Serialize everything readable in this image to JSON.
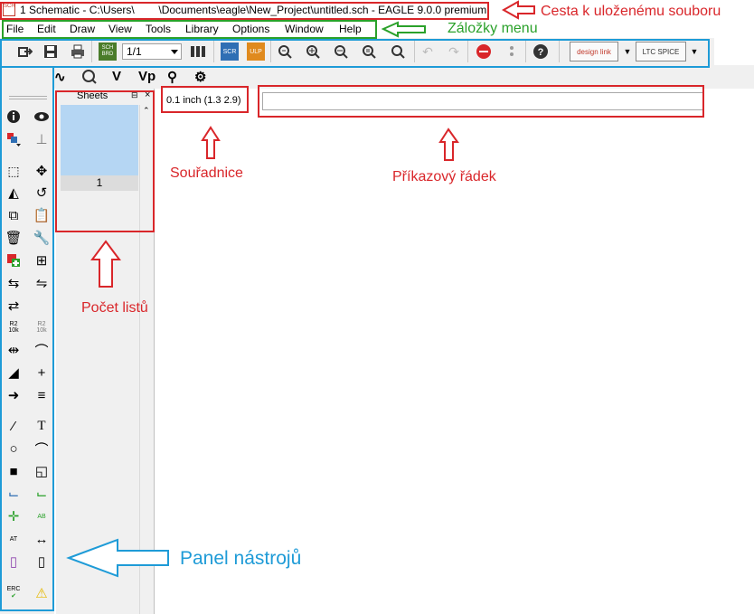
{
  "window": {
    "title": "1 Schematic - C:\\Users\\        \\Documents\\eagle\\New_Project\\untitled.sch - EAGLE 9.0.0 premium",
    "app_icon": "SCH"
  },
  "menu": [
    "File",
    "Edit",
    "Draw",
    "View",
    "Tools",
    "Library",
    "Options",
    "Window",
    "Help"
  ],
  "toolbar": {
    "sheet_value": "1/1",
    "sch_brd_label": "SCH BRD",
    "scr_label": "SCR",
    "ulp_label": "ULP",
    "design_link_label": "design link",
    "ltc_spice_label": "LTC SPICE"
  },
  "toolbar2": {
    "v_label": "V",
    "vp_label": "Vp"
  },
  "sheets_panel": {
    "title": "Sheets",
    "pin_glyph": "⊟",
    "close_glyph": "×",
    "sheet_number": "1"
  },
  "coordinate": "0.1 inch (1.3 2.9)",
  "tools": {
    "r2_label": "R2",
    "r2_value": "10k",
    "ab_label": "AB",
    "at_label": "AT",
    "erc_label": "ERC"
  },
  "annotations": {
    "path_label": "Cesta k uloženému souboru",
    "menu_label": "Záložky menu",
    "coord_label": "Souřadnice",
    "cmd_label": "Příkazový řádek",
    "sheets_label": "Počet listů",
    "tools_label": "Panel nástrojů"
  },
  "colors": {
    "annotation_red": "#d9262a",
    "annotation_green": "#2aa12a",
    "annotation_blue": "#1e9bd7",
    "sheet_thumb": "#b5d6f3"
  }
}
